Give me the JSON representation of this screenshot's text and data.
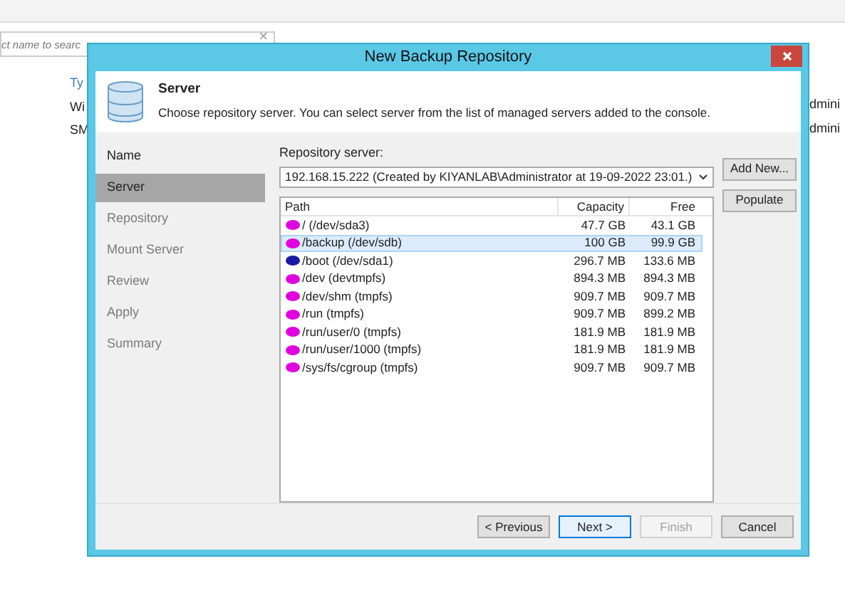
{
  "background": {
    "search": {
      "placeholder": "ct name to searc",
      "clear": "×"
    },
    "texts_left": [
      "Ty",
      "Wi",
      "SM"
    ],
    "texts_right": [
      "dmini",
      "dmini"
    ]
  },
  "window": {
    "title": "New Backup Repository"
  },
  "header": {
    "title": "Server",
    "description": "Choose repository server. You can select server from the list of managed servers added to the console."
  },
  "steps": [
    {
      "label": "Name",
      "selected": false,
      "disabled": false
    },
    {
      "label": "Server",
      "selected": true,
      "disabled": false
    },
    {
      "label": "Repository",
      "selected": false,
      "disabled": true
    },
    {
      "label": "Mount Server",
      "selected": false,
      "disabled": true
    },
    {
      "label": "Review",
      "selected": false,
      "disabled": true
    },
    {
      "label": "Apply",
      "selected": false,
      "disabled": true
    },
    {
      "label": "Summary",
      "selected": false,
      "disabled": true
    }
  ],
  "server": {
    "label": "Repository server:",
    "value": "192.168.15.222 (Created by KIYANLAB\\Administrator at 19-09-2022 23:01.)"
  },
  "side_buttons": [
    "Add New...",
    "Populate"
  ],
  "table": {
    "columns": [
      "Path",
      "Capacity",
      "Free"
    ],
    "rows": [
      {
        "path": "/ (/dev/sda3)",
        "capacity": "47.7 GB",
        "free": "43.1 GB",
        "selected": false,
        "color": "#e000e0"
      },
      {
        "path": "/backup (/dev/sdb)",
        "capacity": "100 GB",
        "free": "99.9 GB",
        "selected": true,
        "color": "#e000e0"
      },
      {
        "path": "/boot (/dev/sda1)",
        "capacity": "296.7 MB",
        "free": "133.6 MB",
        "selected": false,
        "color": "#1a1aa0"
      },
      {
        "path": "/dev (devtmpfs)",
        "capacity": "894.3 MB",
        "free": "894.3 MB",
        "selected": false,
        "color": "#e000e0"
      },
      {
        "path": "/dev/shm (tmpfs)",
        "capacity": "909.7 MB",
        "free": "909.7 MB",
        "selected": false,
        "color": "#e000e0"
      },
      {
        "path": "/run (tmpfs)",
        "capacity": "909.7 MB",
        "free": "899.2 MB",
        "selected": false,
        "color": "#e000e0"
      },
      {
        "path": "/run/user/0 (tmpfs)",
        "capacity": "181.9 MB",
        "free": "181.9 MB",
        "selected": false,
        "color": "#e000e0"
      },
      {
        "path": "/run/user/1000 (tmpfs)",
        "capacity": "181.9 MB",
        "free": "181.9 MB",
        "selected": false,
        "color": "#e000e0"
      },
      {
        "path": "/sys/fs/cgroup (tmpfs)",
        "capacity": "909.7 MB",
        "free": "909.7 MB",
        "selected": false,
        "color": "#e000e0"
      }
    ]
  },
  "buttons": [
    {
      "label": "< Previous",
      "disabled": false,
      "default": false
    },
    {
      "label": "Next >",
      "disabled": false,
      "default": true
    },
    {
      "label": "Finish",
      "disabled": true,
      "default": false
    },
    {
      "label": "Cancel",
      "disabled": false,
      "default": false
    }
  ]
}
